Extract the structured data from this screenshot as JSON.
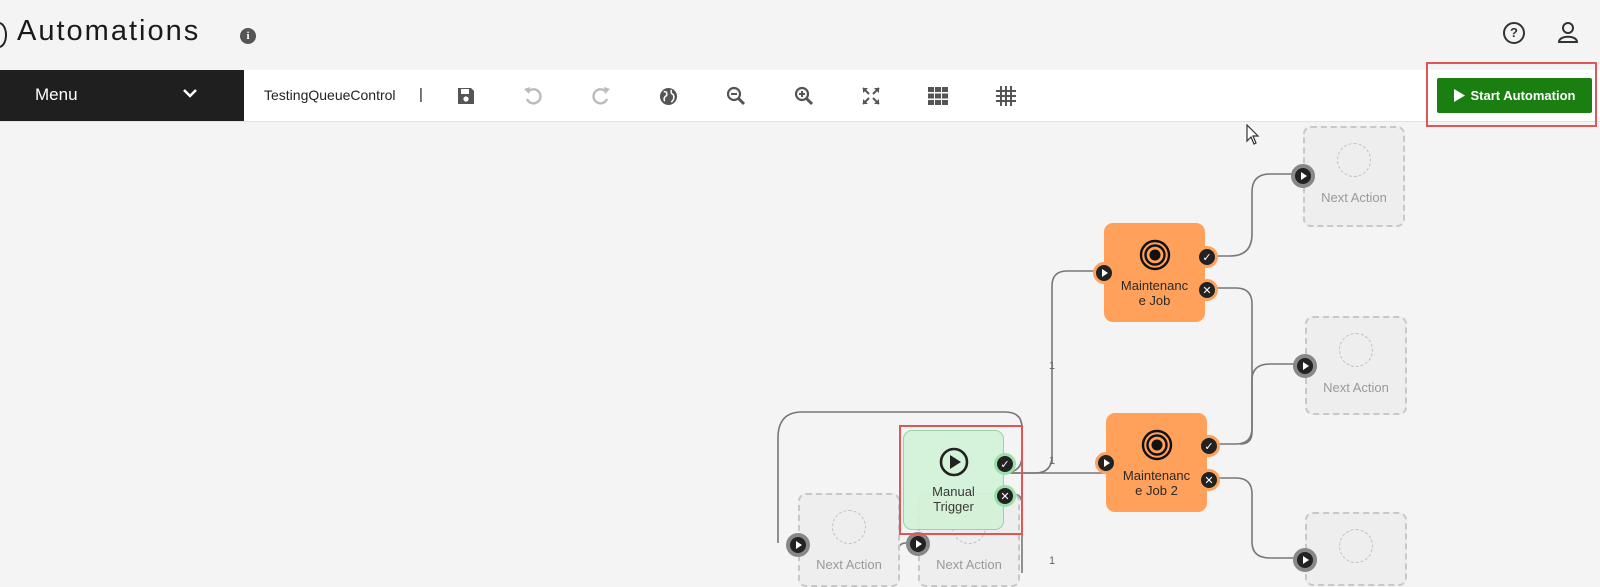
{
  "header": {
    "title": "Automations",
    "info_icon": "info-icon",
    "help_icon": "help-icon",
    "user_icon": "user-icon"
  },
  "toolbar": {
    "menu_label": "Menu",
    "automation_name": "TestingQueueControl",
    "separator": "|",
    "tools": [
      "save-icon",
      "undo-icon",
      "redo-icon",
      "globe-icon",
      "zoom-out-icon",
      "zoom-in-icon",
      "fit-screen-icon",
      "grid-icon",
      "snap-grid-icon"
    ],
    "start_button_label": "Start Automation",
    "start_button_color": "#1a7f10"
  },
  "canvas": {
    "nodes": {
      "trigger": {
        "label_line1": "Manual",
        "label_line2": "Trigger"
      },
      "job1": {
        "label_line1": "Maintenanc",
        "label_line2": "e  Job"
      },
      "job2": {
        "label_line1": "Maintenanc",
        "label_line2": "e  Job 2"
      },
      "next_action_1": "Next Action",
      "next_action_2": "Next Action",
      "next_action_3": "Next Action",
      "next_action_4": "Next Action"
    },
    "edge_labels": [
      "1",
      "1",
      "1"
    ],
    "colors": {
      "action_node": "#ffa15a",
      "trigger_node": "#d3f3d8"
    }
  }
}
